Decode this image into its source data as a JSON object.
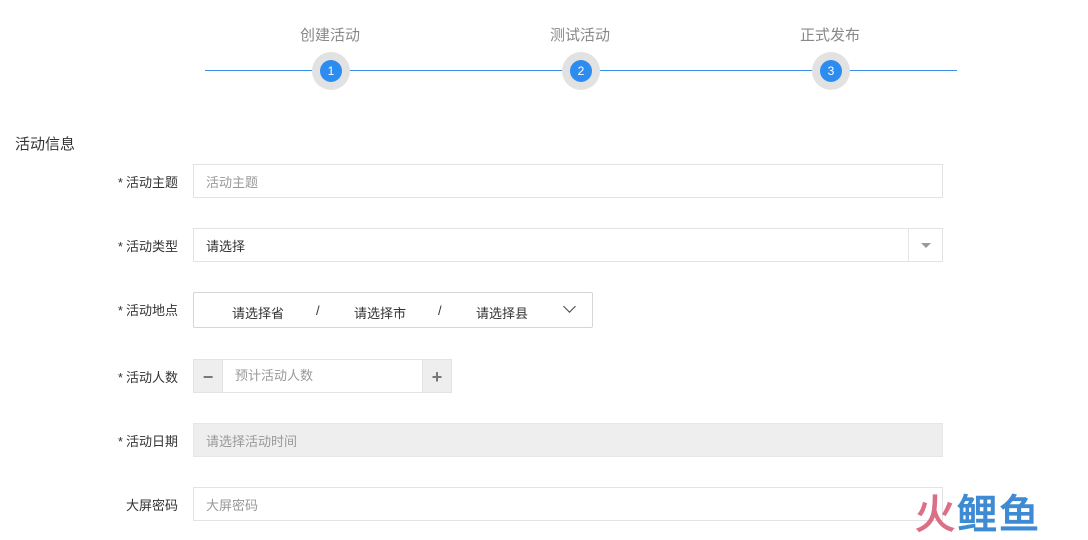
{
  "steps": [
    {
      "title": "创建活动",
      "number": "1"
    },
    {
      "title": "测试活动",
      "number": "2"
    },
    {
      "title": "正式发布",
      "number": "3"
    }
  ],
  "section": {
    "title": "活动信息"
  },
  "form": {
    "required_mark": "*",
    "theme": {
      "label": "活动主题",
      "placeholder": "活动主题"
    },
    "type": {
      "label": "活动类型",
      "value": "请选择"
    },
    "location": {
      "label": "活动地点",
      "province": "请选择省",
      "city": "请选择市",
      "county": "请选择县",
      "separator": "/"
    },
    "people": {
      "label": "活动人数",
      "placeholder": "预计活动人数",
      "minus": "−",
      "plus": "+"
    },
    "date": {
      "label": "活动日期",
      "placeholder": "请选择活动时间"
    },
    "screen_password": {
      "label": "大屏密码",
      "placeholder": "大屏密码"
    }
  },
  "watermark": {
    "char1": "火",
    "char2": "鲤",
    "char3": "鱼"
  },
  "colors": {
    "accent": "#2d8cf0",
    "line": "#3a8ee6"
  }
}
